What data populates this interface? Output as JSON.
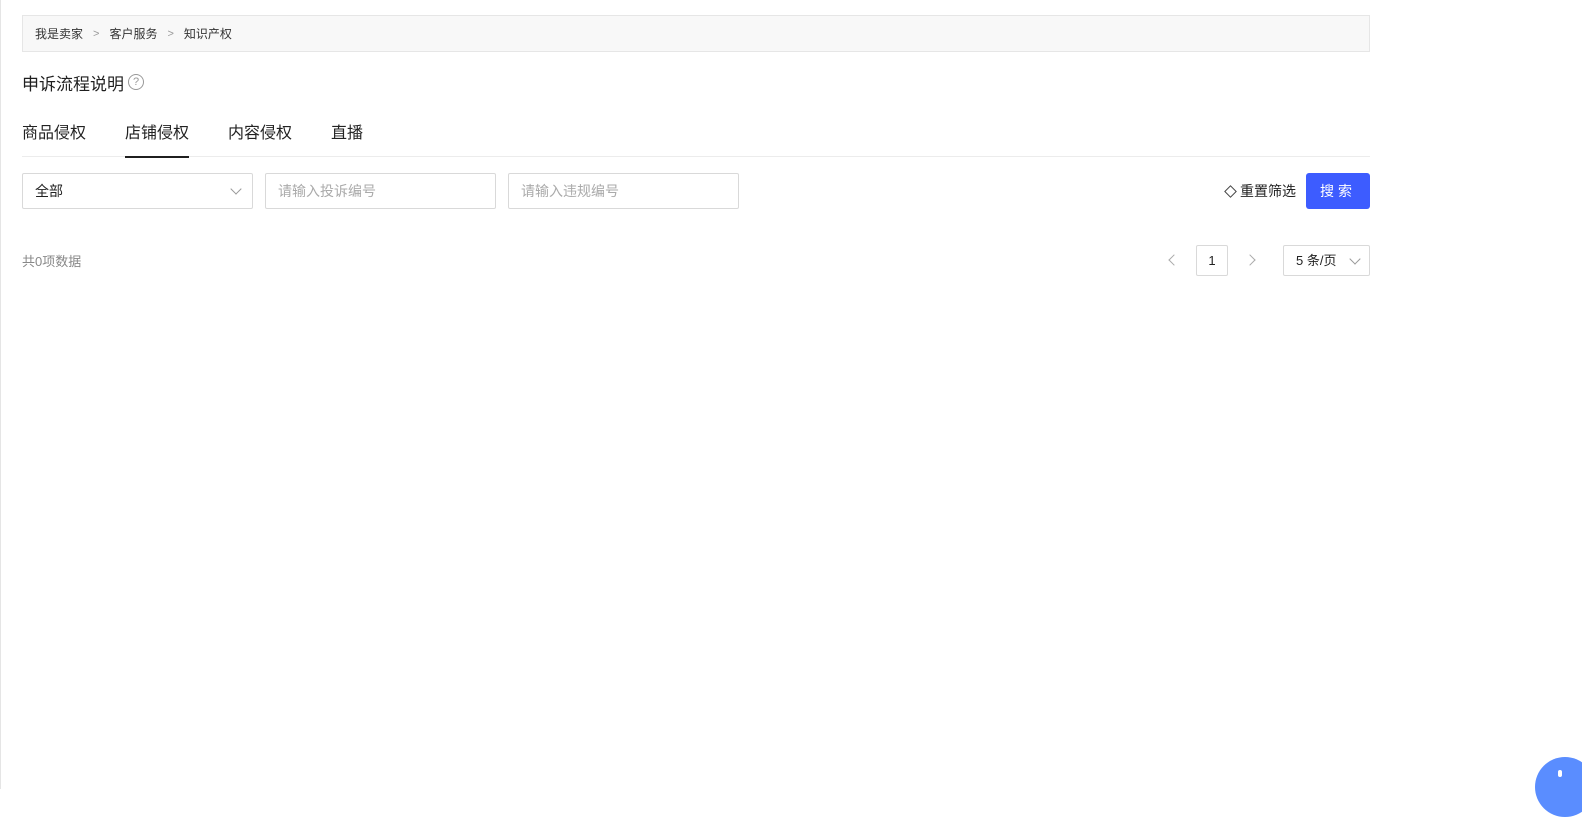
{
  "breadcrumb": {
    "items": [
      "我是卖家",
      "客户服务",
      "知识产权"
    ],
    "separator": ">"
  },
  "page": {
    "title": "申诉流程说明",
    "help_icon": "question-circle-icon"
  },
  "tabs": [
    {
      "label": "商品侵权",
      "active": false
    },
    {
      "label": "店铺侵权",
      "active": true
    },
    {
      "label": "内容侵权",
      "active": false
    },
    {
      "label": "直播",
      "active": false
    }
  ],
  "filters": {
    "status_select": {
      "value": "全部"
    },
    "complaint_no": {
      "placeholder": "请输入投诉编号",
      "value": ""
    },
    "violation_no": {
      "placeholder": "请输入违规编号",
      "value": ""
    },
    "reset_label": "重置筛选",
    "search_label": "搜索"
  },
  "results": {
    "total_text": "共0项数据"
  },
  "pagination": {
    "current_page": "1",
    "page_size": "5 条/页"
  },
  "colors": {
    "primary": "#3d5cff",
    "assistant": "#5a8dff"
  }
}
